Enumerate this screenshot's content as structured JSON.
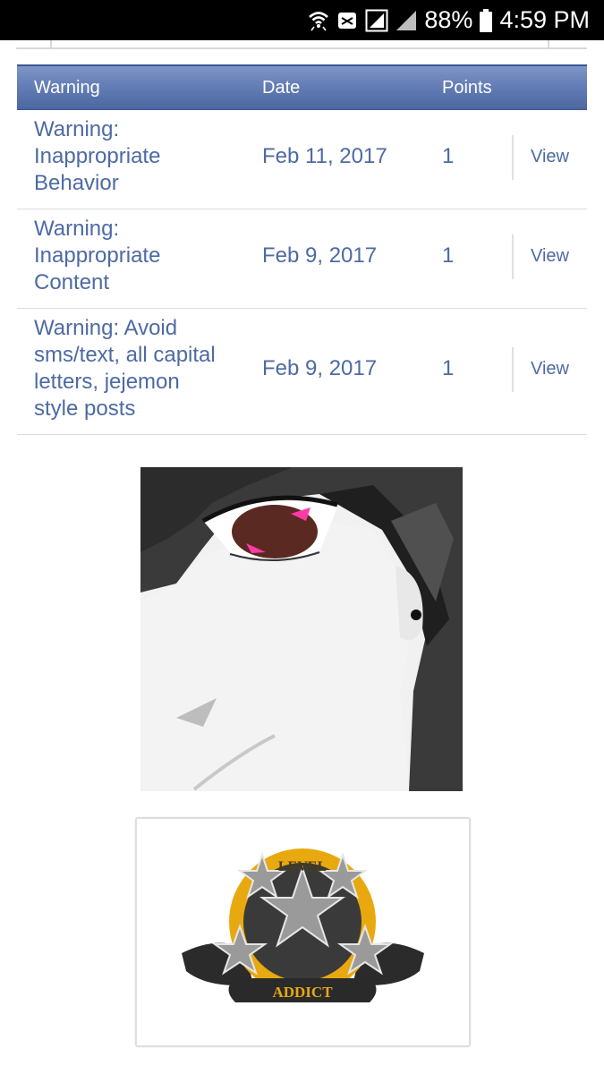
{
  "status_bar": {
    "battery": "88%",
    "time": "4:59 PM",
    "icons": [
      "wifi-icon",
      "message-icon",
      "signal-icon",
      "signal-icon",
      "battery-icon"
    ]
  },
  "table": {
    "headers": {
      "warning": "Warning",
      "date": "Date",
      "points": "Points"
    },
    "rows": [
      {
        "warning_lines": [
          "Warning:",
          "Inappropriate",
          "Behavior"
        ],
        "date": "Feb 11, 2017",
        "points": "1",
        "action": "View"
      },
      {
        "warning_lines": [
          "Warning:",
          "Inappropriate",
          "Content"
        ],
        "date": "Feb 9, 2017",
        "points": "1",
        "action": "View"
      },
      {
        "warning_lines": [
          "Warning: Avoid",
          "sms/text, all capital",
          "letters, jejemon",
          "style posts"
        ],
        "date": "Feb 9, 2017",
        "points": "1",
        "action": "View"
      }
    ]
  },
  "avatar": {
    "description_icon": "anime-avatar-image"
  },
  "badge": {
    "top_text": "LEVEL",
    "bottom_text": "ADDICT"
  },
  "colors": {
    "header_gradient_top": "#7e95c6",
    "header_gradient_bottom": "#4d67a2",
    "link_text": "#4d6aa3",
    "badge_gold": "#e8a910"
  }
}
